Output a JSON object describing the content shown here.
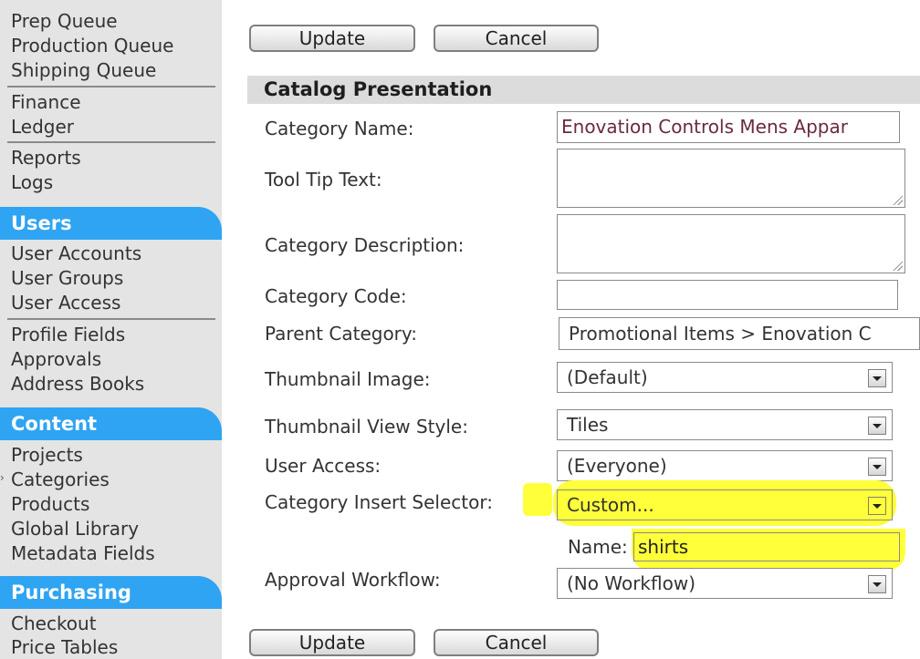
{
  "sidebar": {
    "queues": [
      "Prep Queue",
      "Production Queue",
      "Shipping Queue"
    ],
    "finance": [
      "Finance",
      "Ledger"
    ],
    "reports": [
      "Reports",
      "Logs"
    ],
    "users_header": "Users",
    "users": [
      "User Accounts",
      "User Groups",
      "User Access"
    ],
    "users2": [
      "Profile Fields",
      "Approvals",
      "Address Books"
    ],
    "content_header": "Content",
    "content": [
      "Projects",
      "Categories",
      "Products",
      "Global Library",
      "Metadata Fields"
    ],
    "purchasing_header": "Purchasing",
    "purchasing": [
      "Checkout",
      "Price Tables"
    ]
  },
  "buttons": {
    "update": "Update",
    "cancel": "Cancel"
  },
  "section_title": "Catalog Presentation",
  "form": {
    "category_name_label": "Category Name:",
    "category_name_value": "Enovation Controls Mens Appar",
    "tooltip_label": "Tool Tip Text:",
    "description_label": "Category Description:",
    "code_label": "Category Code:",
    "code_value": "",
    "parent_label": "Parent Category:",
    "parent_value": "Promotional Items > Enovation C",
    "thumb_image_label": "Thumbnail Image:",
    "thumb_image_value": "(Default)",
    "thumb_view_label": "Thumbnail View Style:",
    "thumb_view_value": "Tiles",
    "user_access_label": "User Access:",
    "user_access_value": "(Everyone)",
    "insert_selector_label_a": "Category Insert Selecto",
    "insert_selector_label_b": "r:",
    "insert_selector_value": "Custom...",
    "name_label": "Name:",
    "name_value": "shirts",
    "approval_label": "Approval Workflow:",
    "approval_value": "(No Workflow)"
  },
  "colors": {
    "accent": "#2fa4f2",
    "highlight": "#ffff3a"
  }
}
